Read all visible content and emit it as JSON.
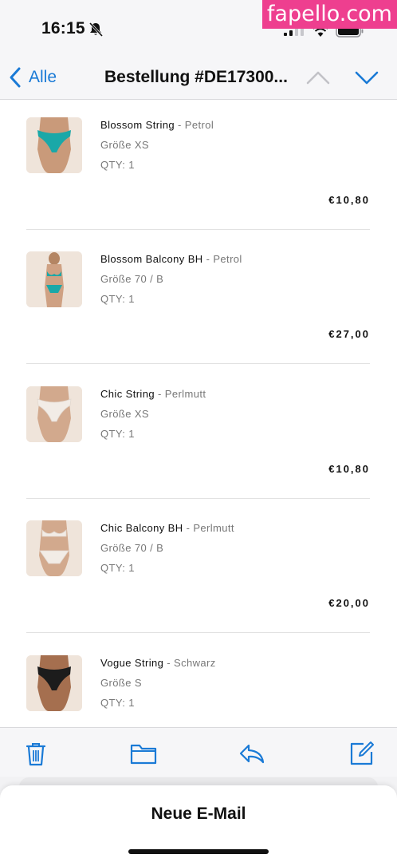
{
  "status_bar": {
    "time": "16:15"
  },
  "watermark": "fapello.com",
  "nav": {
    "back_label": "Alle",
    "title": "Bestellung #DE17300..."
  },
  "items": [
    {
      "name": "Blossom String",
      "separator": "-",
      "variant": "Petrol",
      "size": "Größe XS",
      "qty": "QTY: 1",
      "price": "€10,80",
      "garment": "bottom",
      "color": "#1aa8a8"
    },
    {
      "name": "Blossom Balcony BH",
      "separator": "-",
      "variant": "Petrol",
      "size": "Größe 70 / B",
      "qty": "QTY: 1",
      "price": "€27,00",
      "garment": "full",
      "color": "#1aa8a8"
    },
    {
      "name": "Chic String",
      "separator": "-",
      "variant": "Perlmutt",
      "size": "Größe XS",
      "qty": "QTY: 1",
      "price": "€10,80",
      "garment": "bottom",
      "color": "#f2ece6"
    },
    {
      "name": "Chic Balcony BH",
      "separator": "-",
      "variant": "Perlmutt",
      "size": "Größe 70 / B",
      "qty": "QTY: 1",
      "price": "€20,00",
      "garment": "full",
      "color": "#f2ece6"
    },
    {
      "name": "Vogue String",
      "separator": "-",
      "variant": "Schwarz",
      "size": "Größe S",
      "qty": "QTY: 1",
      "price": "",
      "garment": "bottom",
      "color": "#1c1c1c"
    }
  ],
  "toolbar": {
    "icons": [
      "trash-icon",
      "folder-icon",
      "reply-icon",
      "compose-icon"
    ],
    "accent": "#1a7ad6"
  },
  "sheet": {
    "title": "Neue E-Mail"
  }
}
